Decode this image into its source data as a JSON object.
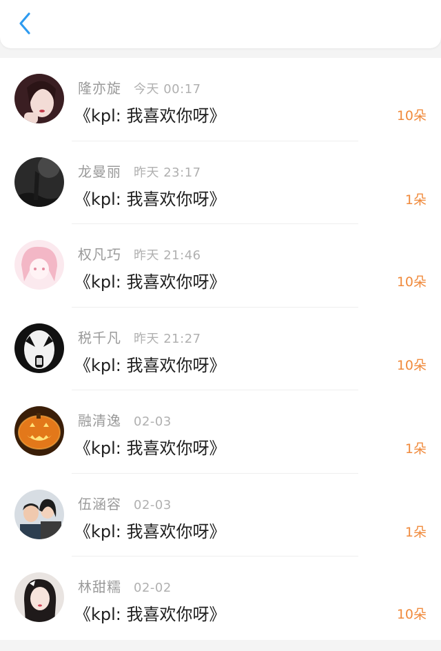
{
  "header": {
    "back_icon": "chevron-left-icon",
    "accent": "#2e9bf0"
  },
  "colors": {
    "name": "#9a9a9a",
    "time": "#b0b0b0",
    "gift": "#1e1e1e",
    "count": "#f08a3c"
  },
  "records": [
    {
      "name": "隆亦旋",
      "time": "今天 00:17",
      "gift": "《kpl: 我喜欢你呀》",
      "count": "10朵",
      "avatar": "girl-portrait-avatar"
    },
    {
      "name": "龙曼丽",
      "time": "昨天 23:17",
      "gift": "《kpl: 我喜欢你呀》",
      "count": "1朵",
      "avatar": "dark-night-avatar"
    },
    {
      "name": "权凡巧",
      "time": "昨天 21:46",
      "gift": "《kpl: 我喜欢你呀》",
      "count": "10朵",
      "avatar": "pink-anime-avatar"
    },
    {
      "name": "税千凡",
      "time": "昨天 21:27",
      "gift": "《kpl: 我喜欢你呀》",
      "count": "10朵",
      "avatar": "kiss-face-avatar"
    },
    {
      "name": "融清逸",
      "time": "02-03",
      "gift": "《kpl: 我喜欢你呀》",
      "count": "1朵",
      "avatar": "pumpkin-avatar"
    },
    {
      "name": "伍涵容",
      "time": "02-03",
      "gift": "《kpl: 我喜欢你呀》",
      "count": "1朵",
      "avatar": "couple-photo-avatar"
    },
    {
      "name": "林甜糯",
      "time": "02-02",
      "gift": "《kpl: 我喜欢你呀》",
      "count": "10朵",
      "avatar": "girl-selfie-avatar"
    }
  ]
}
